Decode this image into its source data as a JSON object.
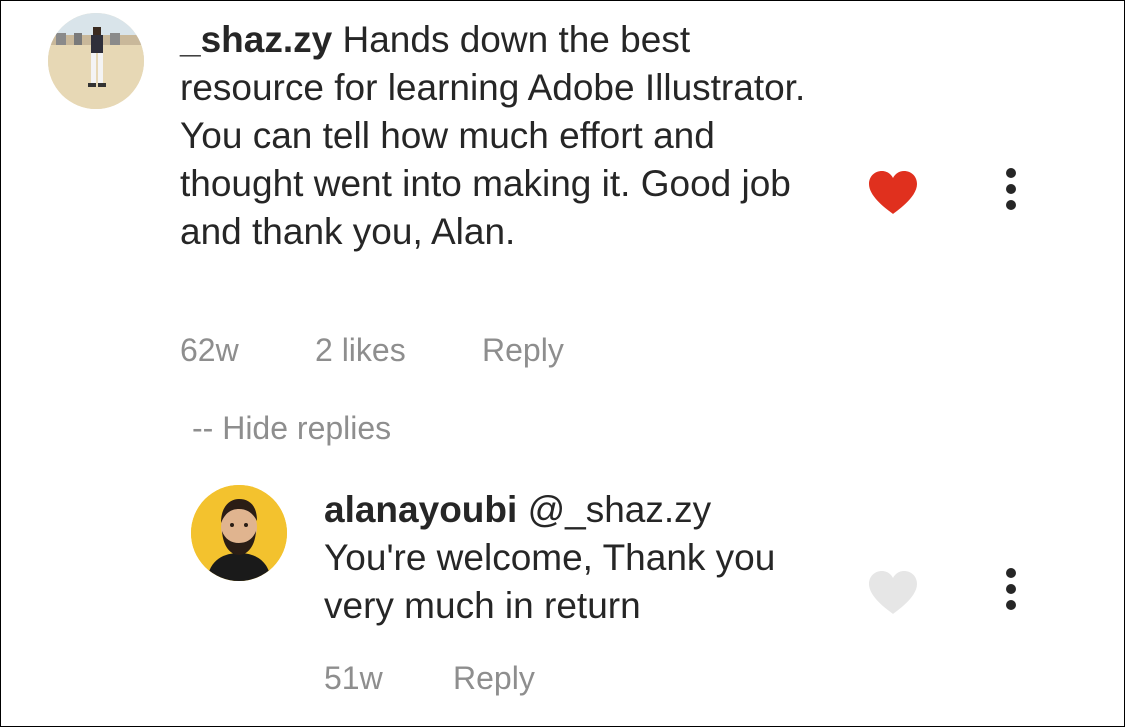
{
  "comment": {
    "username": "_shaz.zy",
    "text": "Hands down the best resource for learning Adobe Illustrator. You can tell how much effort and thought went into making it. Good job and thank you, Alan.",
    "time": "62w",
    "likes": "2 likes",
    "reply_label": "Reply",
    "liked": true,
    "heart_color": "#e0301e"
  },
  "hide_replies_label": "-- Hide replies",
  "reply": {
    "username": "alanayoubi",
    "mention": "@_shaz.zy",
    "text": "You're welcome, Thank you very much in return",
    "time": "51w",
    "reply_label": "Reply",
    "liked": false,
    "heart_color": "#e6e6e6"
  },
  "icons": [
    "avatar",
    "heart-icon",
    "more-options-icon"
  ]
}
